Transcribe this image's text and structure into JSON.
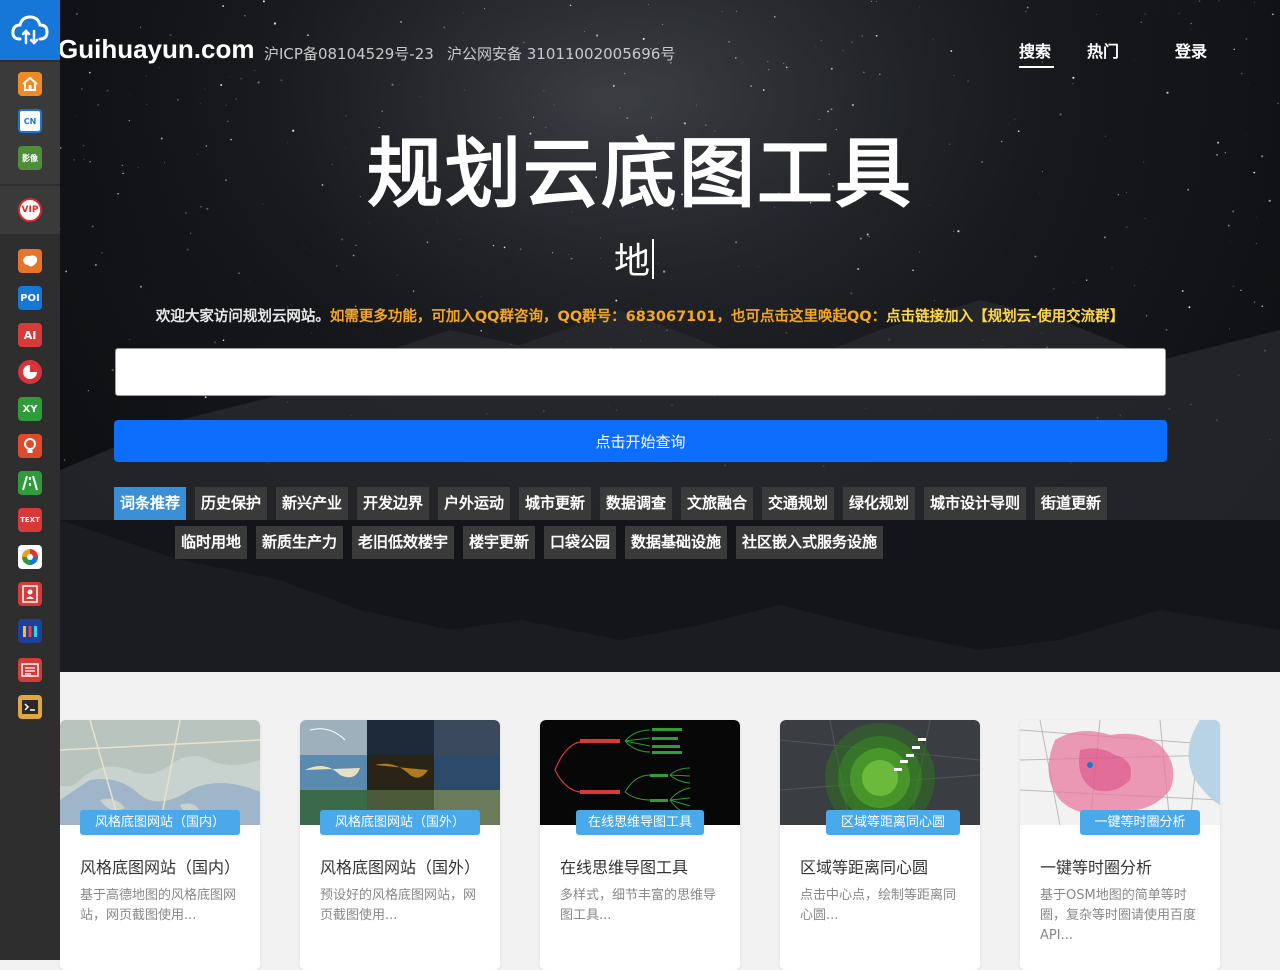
{
  "brand": "Guihuayun.com",
  "icp": "沪ICP备08104529号-23",
  "police": "沪公网安备 31011002005696号",
  "nav": {
    "search": "搜索",
    "hot": "热门",
    "login": "登录"
  },
  "hero_title": "规划云底图工具",
  "typing_text": "地",
  "welcome": {
    "intro": "欢迎大家访问规划云网站。",
    "qq_info": "如需更多功能，可加入QQ群咨询，QQ群号：683067101，也可点击这里唤起QQ：",
    "qq_link": "点击链接加入【规划云-使用交流群】"
  },
  "search": {
    "value": "",
    "button": "点击开始查询"
  },
  "tags": [
    "词条推荐",
    "历史保护",
    "新兴产业",
    "开发边界",
    "户外运动",
    "城市更新",
    "数据调查",
    "文旅融合",
    "交通规划",
    "绿化规划",
    "城市设计导则",
    "街道更新",
    "临时用地",
    "新质生产力",
    "老旧低效楼宇",
    "楼宇更新",
    "口袋公园",
    "数据基础设施",
    "社区嵌入式服务设施"
  ],
  "sidebar_icons": [
    "cloud-upload-icon",
    "home-icon",
    "tianditu-cn-icon",
    "tianditu-imagery-icon",
    "vip-icon",
    "china-map-icon",
    "poi-icon",
    "ai-icon",
    "pie-chart-icon",
    "xy-coordinate-icon",
    "lightbulb-icon",
    "road-icon",
    "text-icon",
    "color-wheel-icon",
    "contact-icon",
    "color-bars-icon",
    "news-icon",
    "terminal-icon"
  ],
  "sidebar_labels": {
    "tianditu_cn": "CN",
    "tianditu_img": "影像",
    "vip": "VIP",
    "poi": "POI",
    "ai": "AI",
    "xy": "XY",
    "text": "TEXT"
  },
  "cards": [
    {
      "badge": "风格底图网站（国内）",
      "title": "风格底图网站（国内）",
      "desc": "基于高德地图的风格底图网站，网页截图使用..."
    },
    {
      "badge": "风格底图网站（国外）",
      "title": "风格底图网站（国外）",
      "desc": "预设好的风格底图网站，网页截图使用..."
    },
    {
      "badge": "在线思维导图工具",
      "title": "在线思维导图工具",
      "desc": "多样式，细节丰富的思维导图工具..."
    },
    {
      "badge": "区域等距离同心圆",
      "title": "区域等距离同心圆",
      "desc": "点击中心点，绘制等距离同心圆..."
    },
    {
      "badge": "一键等时圈分析",
      "title": "一键等时圈分析",
      "desc": "基于OSM地图的简单等时圈，复杂等时圈请使用百度API..."
    }
  ],
  "colors": {
    "primary": "#0d6efd",
    "sidebar": "#2e2e2e",
    "accent_blue": "#1677d9",
    "tag_active": "#3b8fd6",
    "badge": "#49a9ea",
    "orange": "#f5a623",
    "yellow": "#ffd84a"
  }
}
